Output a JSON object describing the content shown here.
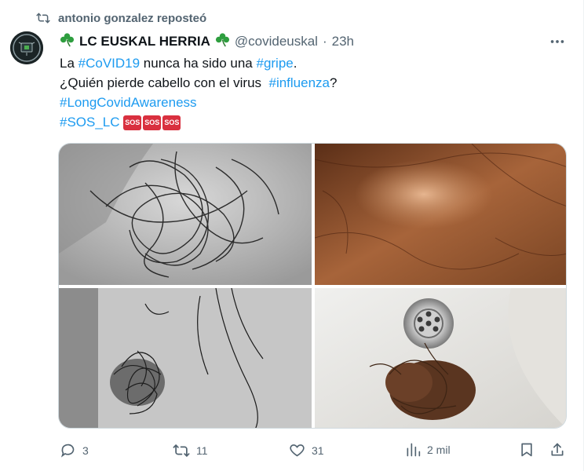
{
  "repost": {
    "text": "antonio gonzalez reposteó",
    "icon": "retweet-icon"
  },
  "tweet": {
    "author_name": "LC EUSKAL HERRIA",
    "handle": "@covideuskal",
    "separator": "·",
    "time": "23h",
    "lines": {
      "l1_pre": "La ",
      "l1_tag1": "#CoVID19",
      "l1_mid": " nunca ha sido una ",
      "l1_tag2": "#gripe",
      "l1_post": ".",
      "l2_pre": "¿Quién pierde cabello con el virus  ",
      "l2_tag": "#influenza",
      "l2_post": "?",
      "l3_tag": "#LongCovidAwareness",
      "l4_tag": "#SOS_LC",
      "sos_emoji": [
        "SOS",
        "SOS",
        "SOS"
      ]
    }
  },
  "media": [
    {
      "description": "hair clump on light background, grayscale"
    },
    {
      "description": "hairline scalp photo"
    },
    {
      "description": "hair clump on gray tiles"
    },
    {
      "description": "hair in sink drain"
    }
  ],
  "actions": {
    "replies": "3",
    "reposts": "11",
    "likes": "31",
    "views": "2 mil"
  },
  "colors": {
    "accent": "#1d9bf0",
    "muted": "#536471",
    "text": "#0f1419",
    "sos": "#d9303f",
    "clover": "#2e9e3f"
  }
}
